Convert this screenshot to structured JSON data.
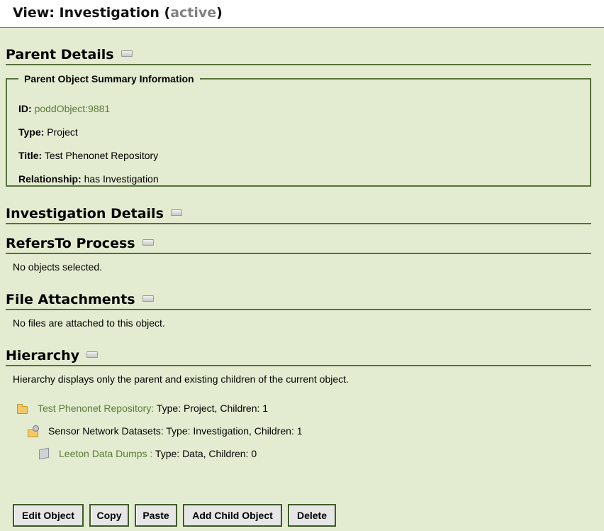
{
  "header": {
    "view_prefix": "View: Investigation (",
    "status": "active",
    "view_suffix": ")"
  },
  "parent_details": {
    "title": "Parent Details",
    "legend": "Parent Object Summary Information",
    "id_label": "ID:",
    "id_value": "poddObject:9881",
    "type_label": "Type:",
    "type_value": "Project",
    "title_label": "Title:",
    "title_value": "Test Phenonet Repository",
    "relationship_label": "Relationship:",
    "relationship_value": "has Investigation"
  },
  "investigation_details": {
    "title": "Investigation Details"
  },
  "refers_to_process": {
    "title": "RefersTo Process",
    "message": "No objects selected."
  },
  "file_attachments": {
    "title": "File Attachments",
    "message": "No files are attached to this object."
  },
  "hierarchy": {
    "title": "Hierarchy",
    "description": "Hierarchy displays only the parent and existing children of the current object.",
    "items": [
      {
        "name": "Test Phenonet Repository:",
        "details": " Type: Project, Children: 1",
        "icon": "folder-icon"
      },
      {
        "name": "Sensor Network Datasets:",
        "details": " Type: Investigation, Children: 1",
        "icon": "folder-gear-icon"
      },
      {
        "name": "Leeton Data Dumps :",
        "details": " Type: Data, Children: 0",
        "icon": "cube-icon"
      }
    ]
  },
  "buttons": {
    "edit": "Edit Object",
    "copy": "Copy",
    "paste": "Paste",
    "add_child": "Add Child Object",
    "delete": "Delete"
  },
  "colors": {
    "background": "#e3ecd0",
    "accent": "#58703a",
    "link": "#5b7a38",
    "status": "#808080"
  }
}
